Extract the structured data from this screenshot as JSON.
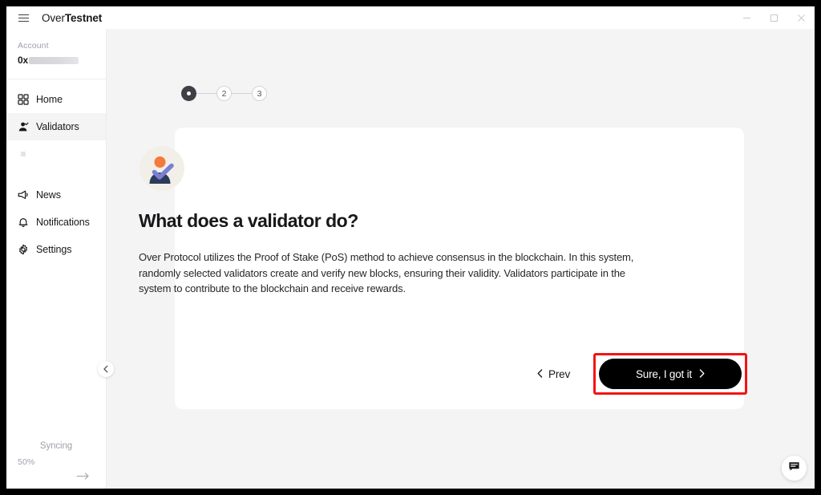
{
  "window": {
    "title_regular": "Over",
    "title_bold": "Testnet",
    "controls": {
      "minimize": "minimize-button",
      "maximize": "maximize-button",
      "close": "close-button"
    }
  },
  "sidebar": {
    "account": {
      "label": "Account",
      "address_prefix": "0x",
      "address_masked": true
    },
    "items": [
      {
        "label": "Home",
        "icon": "grid-icon",
        "active": false
      },
      {
        "label": "Validators",
        "icon": "validator-person-icon",
        "active": true
      },
      {
        "label": "",
        "icon": "placeholder-icon",
        "active": false
      },
      {
        "label": "News",
        "icon": "megaphone-icon",
        "active": false
      },
      {
        "label": "Notifications",
        "icon": "bell-icon",
        "active": false
      },
      {
        "label": "Settings",
        "icon": "gear-icon",
        "active": false
      }
    ],
    "sync": {
      "status": "Syncing",
      "percent": "50%",
      "arrow_icon": "arrow-right-icon"
    },
    "collapse_icon": "chevron-left-icon"
  },
  "stepper": {
    "steps": [
      {
        "label": "1",
        "state": "done"
      },
      {
        "label": "2",
        "state": "idle"
      },
      {
        "label": "3",
        "state": "idle"
      }
    ]
  },
  "card": {
    "illustration": "validator-avatar-illustration",
    "heading": "What does a validator do?",
    "body": "Over Protocol utilizes the Proof of Stake (PoS) method to achieve consensus in the blockchain. In this system, randomly selected validators create and verify new blocks, ensuring their validity. Validators participate in the system to contribute to the blockchain and receive rewards."
  },
  "footer": {
    "prev_label": "Prev",
    "prev_icon": "chevron-left-icon",
    "cta_label": "Sure, I got it",
    "cta_icon": "chevron-right-icon",
    "cta_highlight_color": "#f31414"
  },
  "chat": {
    "icon": "chat-bubble-icon"
  },
  "colors": {
    "app_background": "#ffffff",
    "content_background": "#f4f4f5",
    "card_background": "#ffffff",
    "accent_dark": "#000000",
    "active_nav": "#f4f4f5",
    "muted_text": "#a1a1aa",
    "illustration_head": "#f4793b",
    "illustration_body": "#2c3b5a",
    "illustration_check": "#7b7fd4",
    "illustration_bg": "#f2efe9"
  }
}
